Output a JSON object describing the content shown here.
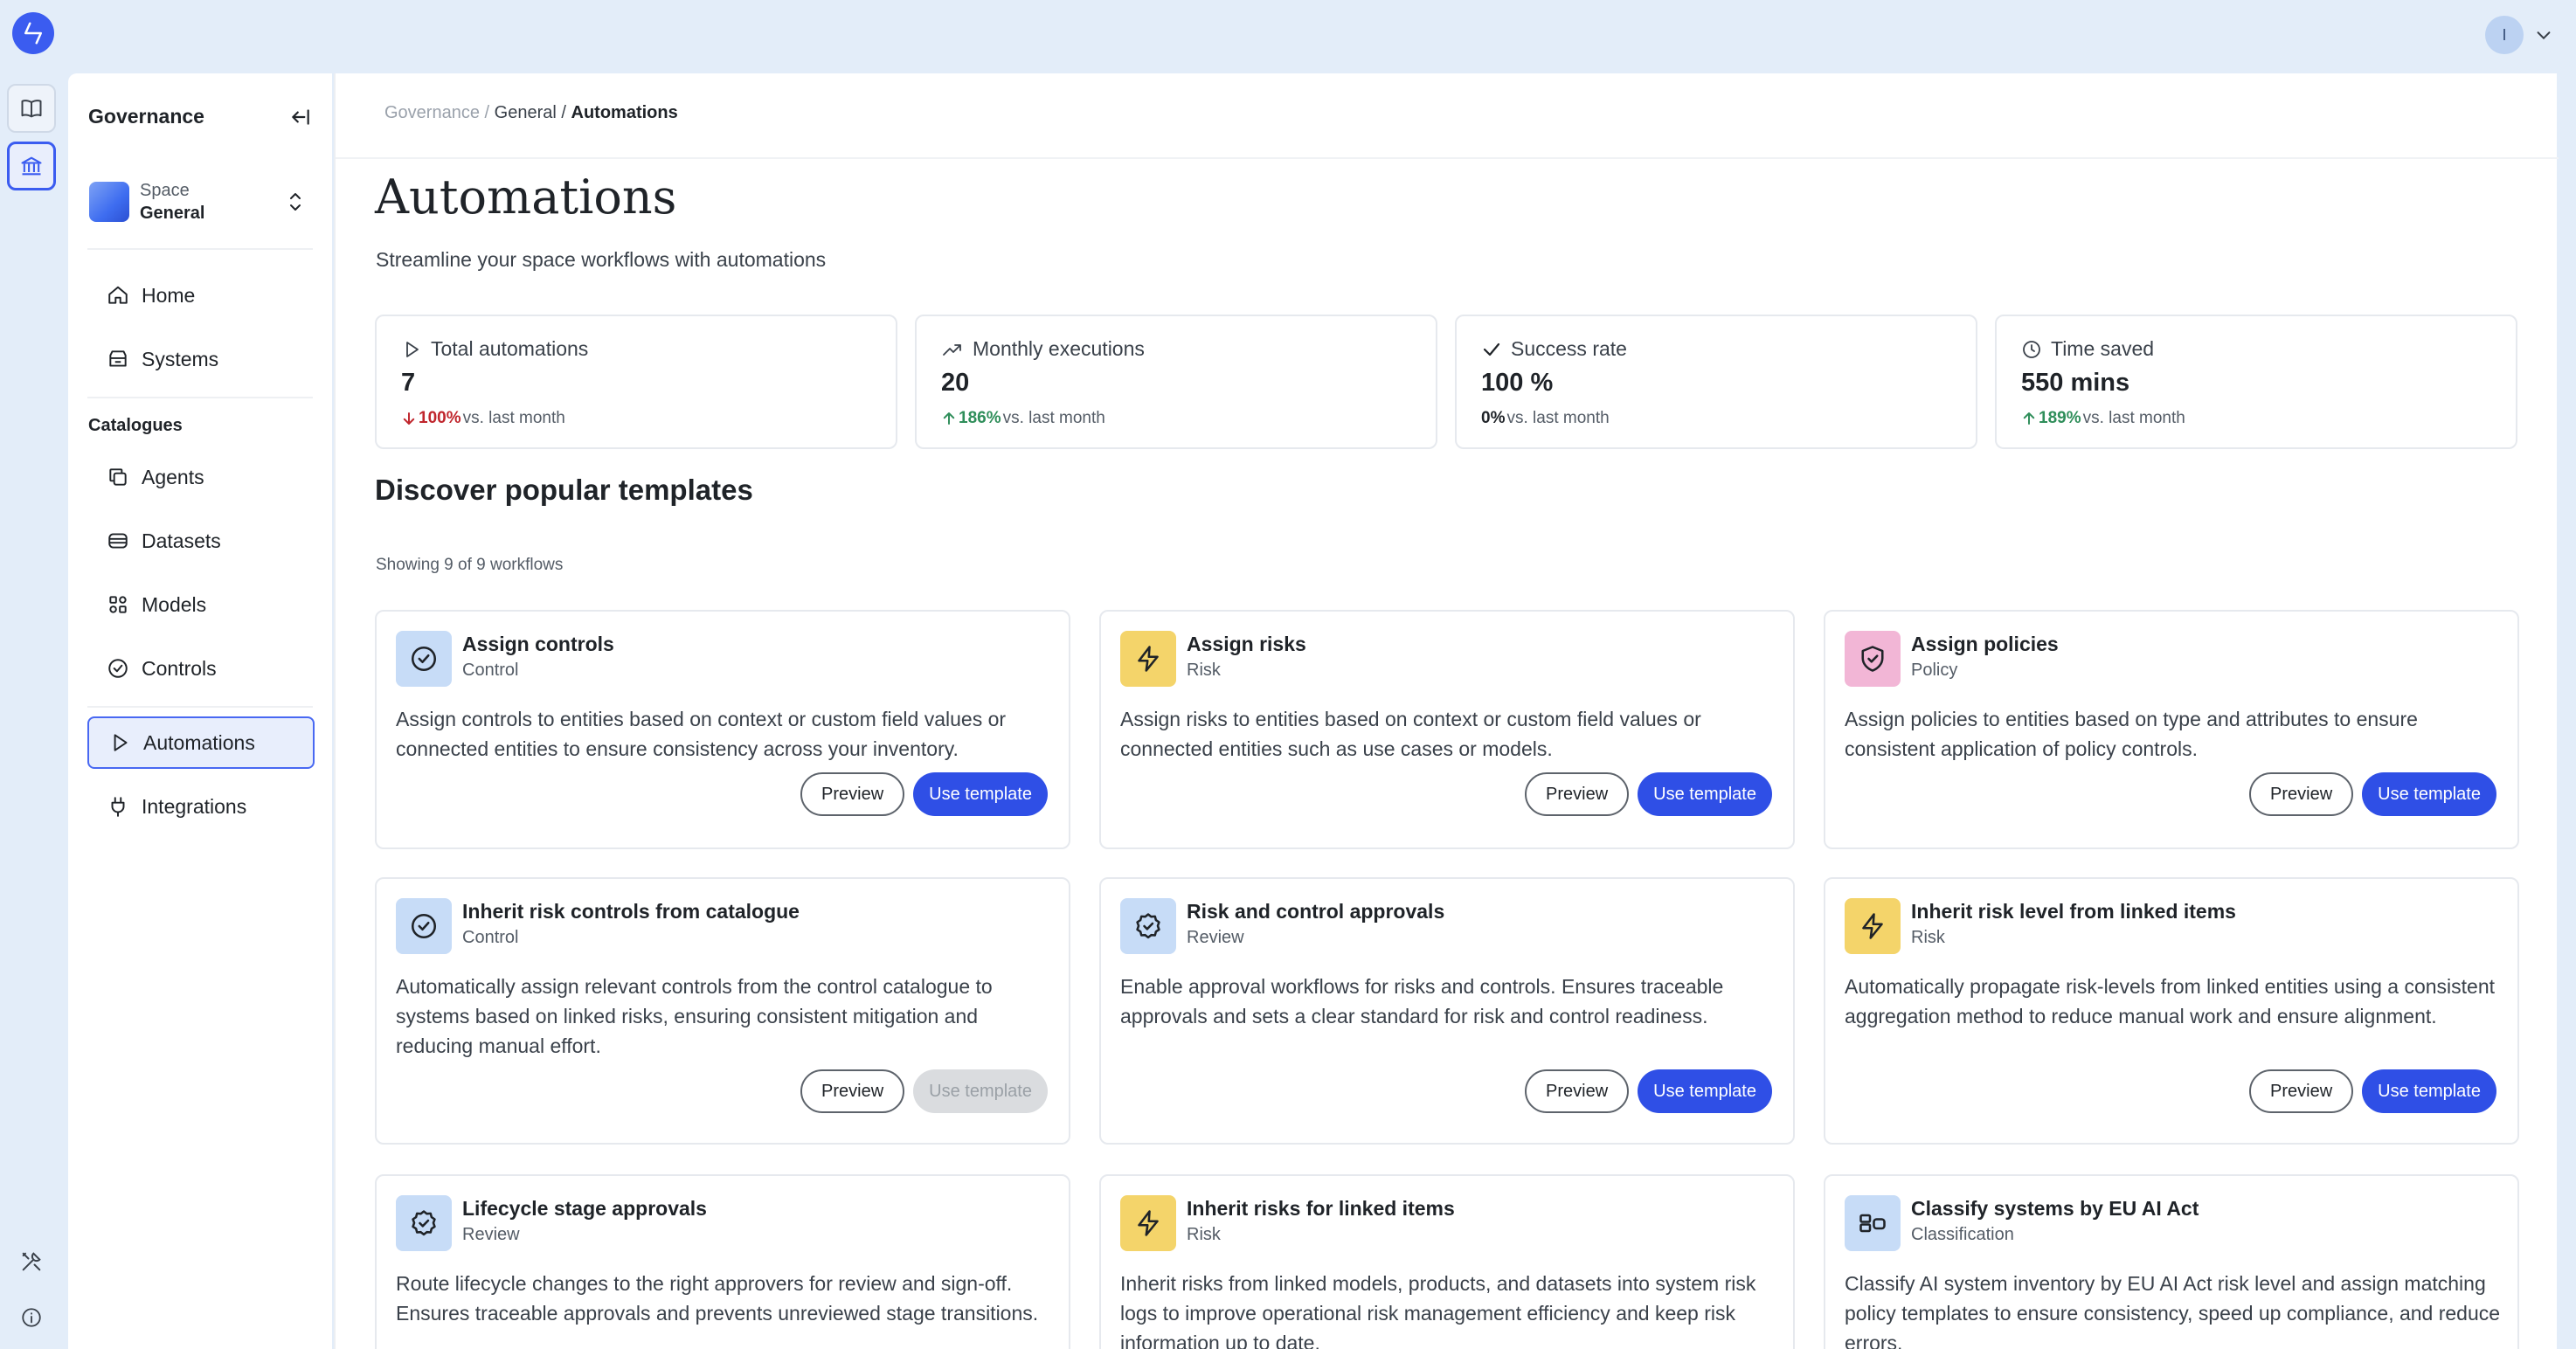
{
  "header": {
    "user_initial": "I"
  },
  "sidebar": {
    "title": "Governance",
    "space": {
      "label": "Space",
      "value": "General"
    },
    "nav_top": [
      {
        "label": "Home",
        "icon": "home-icon"
      },
      {
        "label": "Systems",
        "icon": "systems-icon"
      }
    ],
    "section_label": "Catalogues",
    "nav_catalogues": [
      {
        "label": "Agents",
        "icon": "agents-icon"
      },
      {
        "label": "Datasets",
        "icon": "datasets-icon"
      },
      {
        "label": "Models",
        "icon": "models-icon"
      },
      {
        "label": "Controls",
        "icon": "controls-icon"
      }
    ],
    "nav_bottom": [
      {
        "label": "Automations",
        "icon": "play-icon",
        "active": true
      },
      {
        "label": "Integrations",
        "icon": "plug-icon"
      }
    ]
  },
  "breadcrumb": {
    "root": "Governance",
    "sep": "/",
    "mid": "General",
    "current": "Automations"
  },
  "page": {
    "title": "Automations",
    "subtitle": "Streamline your space workflows with automations"
  },
  "stats": [
    {
      "label": "Total automations",
      "value": "7",
      "change": "100%",
      "direction": "down",
      "suffix": "vs. last month",
      "icon": "play-icon"
    },
    {
      "label": "Monthly executions",
      "value": "20",
      "change": "186%",
      "direction": "up",
      "suffix": "vs. last month",
      "icon": "trending-up-icon"
    },
    {
      "label": "Success rate",
      "value": "100 %",
      "change": "0%",
      "direction": "none",
      "suffix": "vs. last month",
      "icon": "check-icon"
    },
    {
      "label": "Time saved",
      "value": "550 mins",
      "change": "189%",
      "direction": "up",
      "suffix": "vs. last month",
      "icon": "clock-icon"
    }
  ],
  "templates": {
    "heading": "Discover popular templates",
    "showing": "Showing 9 of 9 workflows",
    "preview_label": "Preview",
    "use_label": "Use template",
    "items": [
      {
        "title": "Assign controls",
        "type": "Control",
        "icon": "check-circle-icon",
        "color": "#c7dcf7",
        "description": "Assign controls to entities based on context or custom field values or connected entities to ensure consistency across your inventory.",
        "use_enabled": true
      },
      {
        "title": "Assign risks",
        "type": "Risk",
        "icon": "lightning-icon",
        "color": "#f4d46a",
        "description": "Assign risks to entities based on context or custom field values or connected entities such as use cases or models.",
        "use_enabled": true
      },
      {
        "title": "Assign policies",
        "type": "Policy",
        "icon": "shield-check-icon",
        "color": "#f2b6d6",
        "description": "Assign policies to entities based on type and attributes to ensure consistent application of policy controls.",
        "use_enabled": true
      },
      {
        "title": "Inherit risk controls from catalogue",
        "type": "Control",
        "icon": "check-circle-icon",
        "color": "#c7dcf7",
        "description": "Automatically assign relevant controls from the control catalogue to systems based on linked risks, ensuring consistent mitigation and reducing manual effort.",
        "use_enabled": false
      },
      {
        "title": "Risk and control approvals",
        "type": "Review",
        "icon": "badge-check-icon",
        "color": "#c7dcf7",
        "description": "Enable approval workflows for risks and controls. Ensures traceable approvals and sets a clear standard for risk and control readiness.",
        "use_enabled": true
      },
      {
        "title": "Inherit risk level from linked items",
        "type": "Risk",
        "icon": "lightning-icon",
        "color": "#f4d46a",
        "description": "Automatically propagate risk-levels from linked entities using a consistent aggregation method to reduce manual work and ensure alignment.",
        "use_enabled": true
      },
      {
        "title": "Lifecycle stage approvals",
        "type": "Review",
        "icon": "badge-check-icon",
        "color": "#c7dcf7",
        "description": "Route lifecycle changes to the right approvers for review and sign-off. Ensures traceable approvals and prevents unreviewed stage transitions.",
        "use_enabled": true
      },
      {
        "title": "Inherit risks for linked items",
        "type": "Risk",
        "icon": "lightning-icon",
        "color": "#f4d46a",
        "description": "Inherit risks from linked models, products, and datasets into system risk logs to improve operational risk management efficiency and keep risk information up to date.",
        "use_enabled": true
      },
      {
        "title": "Classify systems by EU AI Act",
        "type": "Classification",
        "icon": "classify-icon",
        "color": "#c7dcf7",
        "description": "Classify AI system inventory by EU AI Act risk level and assign matching policy templates to ensure consistency, speed up compliance, and reduce errors.",
        "use_enabled": true
      }
    ]
  }
}
